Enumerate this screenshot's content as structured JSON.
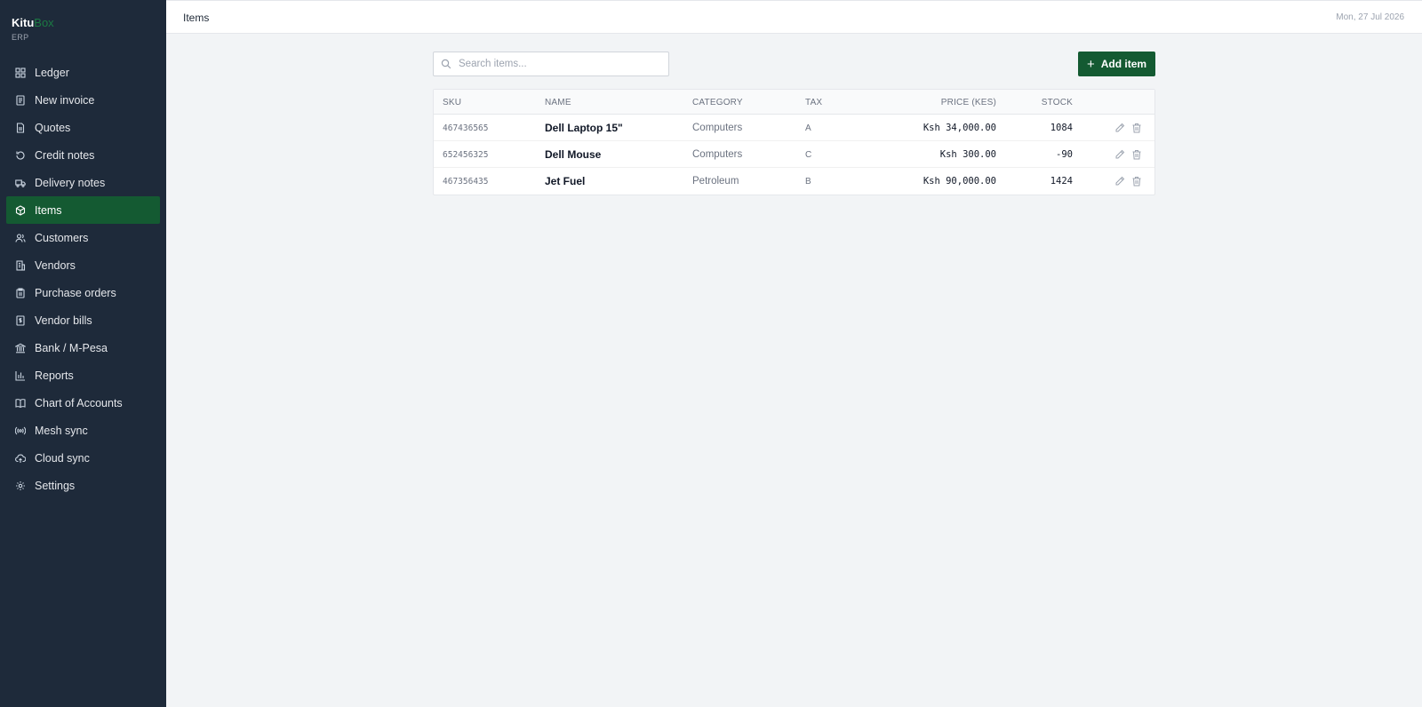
{
  "brand": {
    "name_main": "Kitu",
    "name_accent": "Box",
    "subtitle": "ERP"
  },
  "sidebar": {
    "items": [
      {
        "label": "Ledger",
        "icon": "grid-icon",
        "active": false
      },
      {
        "label": "New invoice",
        "icon": "invoice-icon",
        "active": false
      },
      {
        "label": "Quotes",
        "icon": "document-icon",
        "active": false
      },
      {
        "label": "Credit notes",
        "icon": "rotate-icon",
        "active": false
      },
      {
        "label": "Delivery notes",
        "icon": "truck-icon",
        "active": false
      },
      {
        "label": "Items",
        "icon": "box-icon",
        "active": true
      },
      {
        "label": "Customers",
        "icon": "users-icon",
        "active": false
      },
      {
        "label": "Vendors",
        "icon": "building-icon",
        "active": false
      },
      {
        "label": "Purchase orders",
        "icon": "clipboard-icon",
        "active": false
      },
      {
        "label": "Vendor bills",
        "icon": "bill-icon",
        "active": false
      },
      {
        "label": "Bank / M-Pesa",
        "icon": "bank-icon",
        "active": false
      },
      {
        "label": "Reports",
        "icon": "bar-chart-icon",
        "active": false
      },
      {
        "label": "Chart of Accounts",
        "icon": "book-icon",
        "active": false
      },
      {
        "label": "Mesh sync",
        "icon": "radio-icon",
        "active": false
      },
      {
        "label": "Cloud sync",
        "icon": "cloud-icon",
        "active": false
      },
      {
        "label": "Settings",
        "icon": "gear-icon",
        "active": false
      }
    ]
  },
  "header": {
    "title": "Items",
    "date": "Mon, 27 Jul 2026"
  },
  "search": {
    "placeholder": "Search items...",
    "value": ""
  },
  "toolbar": {
    "add_label": "Add item"
  },
  "table": {
    "columns": {
      "sku": "SKU",
      "name": "NAME",
      "category": "CATEGORY",
      "tax": "TAX",
      "price": "PRICE (KES)",
      "stock": "STOCK"
    },
    "rows": [
      {
        "sku": "467436565",
        "name": "Dell Laptop 15\"",
        "category": "Computers",
        "tax": "A",
        "price": "Ksh 34,000.00",
        "stock": "1084"
      },
      {
        "sku": "652456325",
        "name": "Dell Mouse",
        "category": "Computers",
        "tax": "C",
        "price": "Ksh 300.00",
        "stock": "-90"
      },
      {
        "sku": "467356435",
        "name": "Jet Fuel",
        "category": "Petroleum",
        "tax": "B",
        "price": "Ksh 90,000.00",
        "stock": "1424"
      }
    ]
  },
  "colors": {
    "sidebar_bg": "#1e2a3a",
    "accent": "#145a32",
    "brand_accent": "#1b7a43",
    "page_bg": "#f2f4f6"
  }
}
